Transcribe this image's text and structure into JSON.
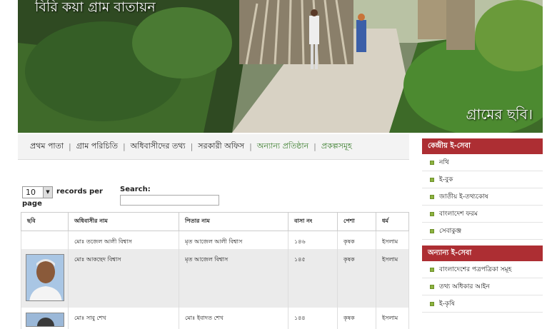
{
  "banner": {
    "title": "বিরি কয়া গ্রাম বাতায়ন",
    "caption": "গ্রামের ছবি।"
  },
  "nav": {
    "items": [
      {
        "label": "প্রথম পাতা",
        "color": "#222222"
      },
      {
        "label": "গ্রাম পরিচিতি",
        "color": "#222222"
      },
      {
        "label": "অধিবাসীদের তথ্য",
        "color": "#222222"
      },
      {
        "label": "সরকারী অফিস",
        "color": "#222222"
      },
      {
        "label": "অন্যান্য প্রতিষ্ঠান",
        "color": "#3a7d2c"
      },
      {
        "label": "প্রকল্পসমূহ",
        "color": "#3a7d2c"
      }
    ]
  },
  "table_controls": {
    "page_length": "10",
    "records_label": "records per",
    "records_label_cont": "page",
    "search_label": "Search:"
  },
  "table": {
    "headers": [
      "ছবি",
      "অধিবাসীর নাম",
      "পিতার নাম",
      "বাসা নং",
      "পেশা",
      "ধর্ম"
    ],
    "rows": [
      {
        "name": "মোঃ তজেল আলী বিশ্বাস",
        "father": "মৃত আজেল আলী বিশ্বাস",
        "house": "১৪৬",
        "profession": "কৃষক",
        "religion": "ইসলাম",
        "photo": ""
      },
      {
        "name": "মোঃ আকছেদ বিশ্বাস",
        "father": "মৃত আজেল বিশ্বাস",
        "house": "১৪৫",
        "profession": "কৃষক",
        "religion": "ইসলাম",
        "photo": "person-photo"
      },
      {
        "name": "মোঃ সাবু শেখ",
        "father": "মোঃ ইবাদত শেখ",
        "house": "১৪৪",
        "profession": "কৃষক",
        "religion": "ইসলাম",
        "photo": "person-photo"
      }
    ]
  },
  "sidebar": {
    "sections": [
      {
        "title": "কেন্দ্রীয় ই-সেবা",
        "items": [
          "নথি",
          "ই-বুক",
          "জাতীয় ই-তথ্যকোষ",
          "বাংলাদেশ ফরম",
          "সেবাকুঞ্জ"
        ]
      },
      {
        "title": "অন্যান্য ই-সেবা",
        "items": [
          "বাংলাদেশের পত্রপত্রিকা সমূহ",
          "তথ্য অধিকার আইন",
          "ই-কৃষি"
        ]
      }
    ],
    "header_color": "#ad2e33",
    "bullet_color": "#8cb33f"
  }
}
